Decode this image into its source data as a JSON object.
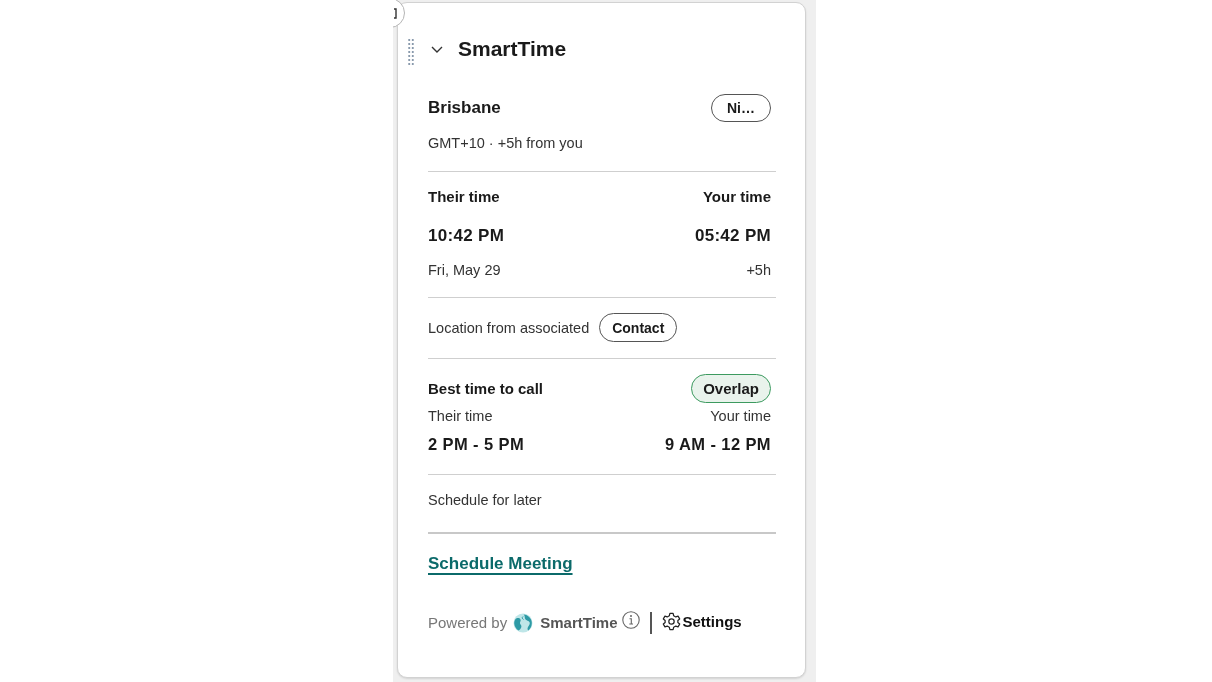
{
  "panel": {
    "title": "SmartTime",
    "expanded": true
  },
  "location": {
    "city": "Brisbane",
    "zone_button": "Ni…",
    "offset": "GMT+10 · +5h from you"
  },
  "times": {
    "their_label": "Their time",
    "your_label": "Your time",
    "their_time": "10:42 PM",
    "your_time": "05:42 PM",
    "their_date": "Fri, May 29",
    "your_offset": "+5h"
  },
  "source": {
    "text": "Location from associated",
    "button": "Contact"
  },
  "best_time": {
    "title": "Best time to call",
    "badge": "Overlap",
    "their_label": "Their time",
    "your_label": "Your time",
    "their_range": "2 PM - 5 PM",
    "your_range": "9 AM - 12 PM"
  },
  "schedule_later": "Schedule for later",
  "schedule_link": "Schedule Meeting",
  "footer": {
    "powered_by": "Powered by",
    "brand": "SmartTime",
    "settings": "Settings"
  }
}
